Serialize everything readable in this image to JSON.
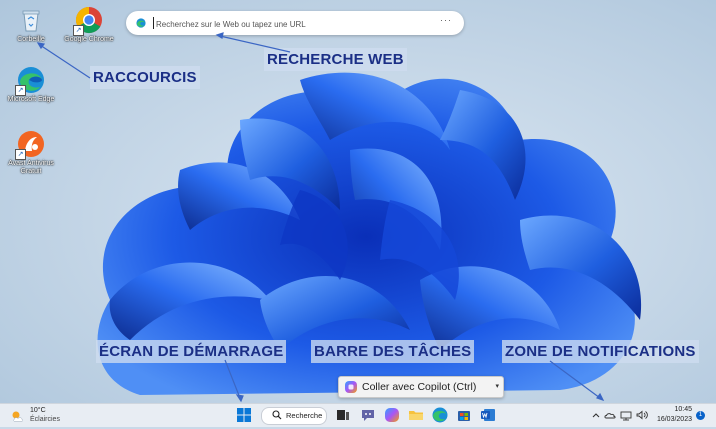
{
  "desktop": {
    "icons": [
      {
        "label": "Corbeille",
        "icon": "recycle-bin-icon"
      },
      {
        "label": "Google Chrome",
        "icon": "chrome-icon"
      },
      {
        "label": "Microsoft Edge",
        "icon": "edge-icon"
      },
      {
        "label": "Avast Antivirus Gratuit",
        "icon": "avast-icon"
      }
    ]
  },
  "web_search": {
    "placeholder": "Recherchez sur le Web ou tapez une URL",
    "more_label": "···"
  },
  "callouts": {
    "raccourcis": "RACCOURCIS",
    "recherche_web": "RECHERCHE WEB",
    "ecran_demarrage": "ÉCRAN DE DÉMARRAGE",
    "barre_taches": "BARRE DES TÂCHES",
    "zone_notifications": "ZONE DE NOTIFICATIONS"
  },
  "copilot_popup": {
    "label": "Coller avec Copilot (Ctrl)",
    "caret": "▾"
  },
  "taskbar": {
    "weather": {
      "temp": "10°C",
      "condition": "Éclaircies"
    },
    "search_label": "Recherche",
    "apps": [
      "task-view-icon",
      "teams-chat-icon",
      "copilot-icon",
      "file-explorer-icon",
      "edge-icon",
      "store-icon",
      "word-icon"
    ],
    "clock": {
      "time": "10:45",
      "date": "16/03/2023"
    },
    "notification_count": "1"
  },
  "colors": {
    "callout_text": "#1b2f86",
    "bloom_blue": "#1f5fe0",
    "taskbar_bg": "#e8edf3"
  }
}
